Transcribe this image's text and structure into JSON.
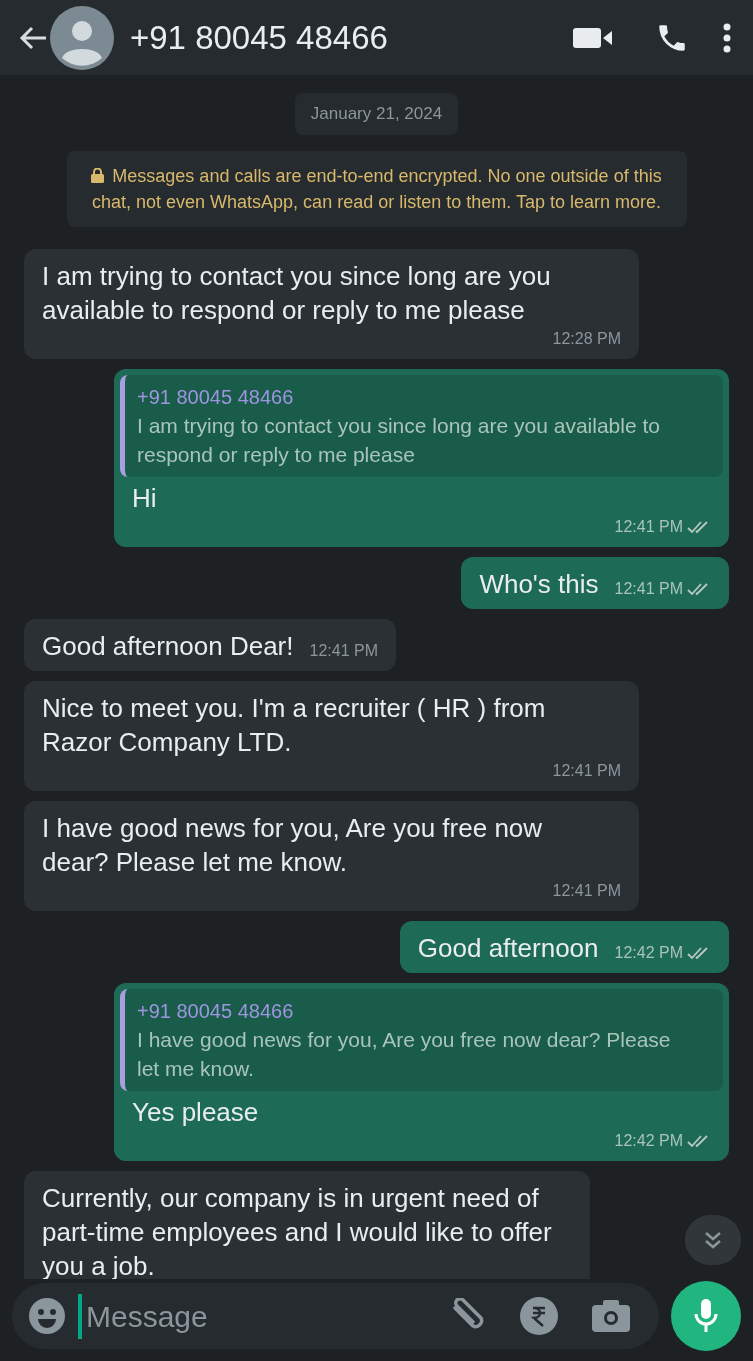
{
  "header": {
    "contact": "+91 80045 48466"
  },
  "date_chip": "January 21, 2024",
  "encryption_notice": "Messages and calls are end-to-end encrypted. No one outside of this chat, not even WhatsApp, can read or listen to them. Tap to learn more.",
  "messages": [
    {
      "kind": "incoming",
      "text": "I am trying to contact you since long are you available to respond or reply to me please",
      "time": "12:28 PM"
    },
    {
      "kind": "outgoing",
      "quote": {
        "author": "+91 80045 48466",
        "text": "I am trying to contact you since long are you available to respond or reply to me please"
      },
      "text": "Hi",
      "time": "12:41 PM",
      "read": true
    },
    {
      "kind": "outgoing",
      "text": "Who's this",
      "time": "12:41 PM",
      "read": true
    },
    {
      "kind": "incoming",
      "text": "Good afternoon Dear!",
      "time": "12:41 PM"
    },
    {
      "kind": "incoming",
      "text": "Nice to meet you. I'm a recruiter ( HR ) from Razor Company LTD.",
      "time": "12:41 PM"
    },
    {
      "kind": "incoming",
      "text": "I have good news for you, Are you free now dear? Please let me know.",
      "time": "12:41 PM"
    },
    {
      "kind": "outgoing",
      "text": "Good afternoon",
      "time": "12:42 PM",
      "read": true
    },
    {
      "kind": "outgoing",
      "quote": {
        "author": "+91 80045 48466",
        "text": "I have good news for you, Are you free now dear? Please let me know."
      },
      "text": "Yes please",
      "time": "12:42 PM",
      "read": true
    },
    {
      "kind": "incoming",
      "text": "Currently, our company is in urgent need of part-time employees and I would like to offer you a job."
    }
  ],
  "composer": {
    "placeholder": "Message"
  }
}
